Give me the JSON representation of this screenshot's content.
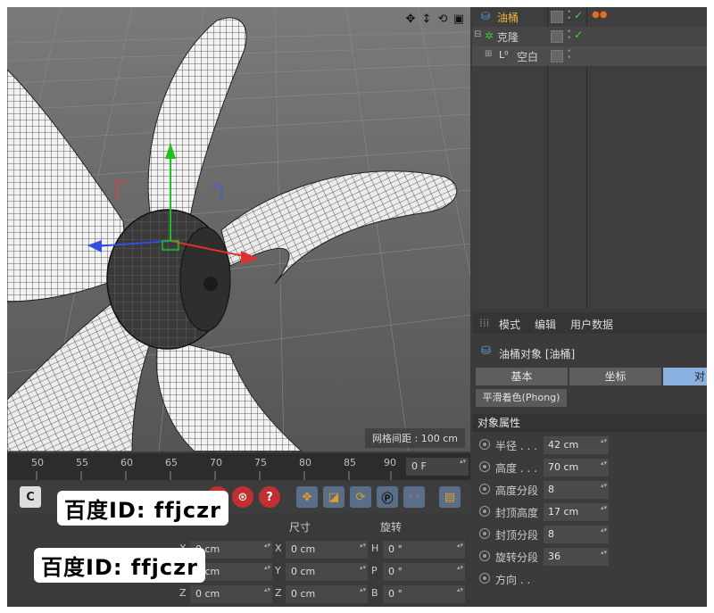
{
  "viewport": {
    "grid_info": "网格间距 : 100 cm",
    "icons": [
      "move-view-icon",
      "pan-view-icon",
      "rotate-view-icon",
      "maximize-view-icon"
    ]
  },
  "timeline": {
    "ticks": [
      "50",
      "55",
      "60",
      "65",
      "70",
      "75",
      "80",
      "85",
      "90"
    ],
    "current_frame": "0 F"
  },
  "toolbar": {
    "buttons": [
      "undo-icon",
      "record-icon",
      "keyframe-icon",
      "help-icon",
      "move-tool-icon",
      "scale-tool-icon",
      "rotate-tool-icon",
      "point-mode-icon",
      "grid-dots-icon",
      "film-icon"
    ],
    "accent": "#e0a020"
  },
  "coords": {
    "headers": {
      "size": "尺寸",
      "rotation": "旋转"
    },
    "rows": [
      {
        "pos_axis": "X",
        "pos": "0 cm",
        "size_axis": "X",
        "size": "0 cm",
        "rot_axis": "H",
        "rot": "0 °"
      },
      {
        "pos_axis": "Y",
        "pos": "0 cm",
        "size_axis": "Y",
        "size": "0 cm",
        "rot_axis": "P",
        "rot": "0 °"
      },
      {
        "pos_axis": "Z",
        "pos": "0 cm",
        "size_axis": "Z",
        "size": "0 cm",
        "rot_axis": "B",
        "rot": "0 °"
      }
    ]
  },
  "watermark": {
    "text1": "百度ID: ffjczr",
    "text2": "百度ID: ffjczr"
  },
  "object_manager": {
    "items": [
      {
        "name": "油桶",
        "color": "#e8b23a",
        "icon": "cylinder-icon"
      },
      {
        "name": "克隆",
        "color": "#d0d0d0",
        "icon": "cloner-icon"
      },
      {
        "name": "空白",
        "color": "#d0d0d0",
        "icon": "null-object-icon"
      }
    ]
  },
  "attribute_manager": {
    "menu": [
      "模式",
      "编辑",
      "用户数据"
    ],
    "object_title": "油桶对象 [油桶]",
    "tabs": [
      "基本",
      "坐标",
      "对"
    ],
    "phong": "平滑着色(Phong)",
    "section": "对象属性",
    "props": [
      {
        "label": "半径 . . .",
        "value": "42 cm"
      },
      {
        "label": "高度 . . .",
        "value": "70 cm"
      },
      {
        "label": "高度分段",
        "value": "8"
      },
      {
        "label": "封顶高度",
        "value": "17 cm"
      },
      {
        "label": "封顶分段",
        "value": "8"
      },
      {
        "label": "旋转分段",
        "value": "36"
      },
      {
        "label": "方向 . .",
        "value": ""
      }
    ],
    "tab_active_color": "#8ab0e0"
  }
}
